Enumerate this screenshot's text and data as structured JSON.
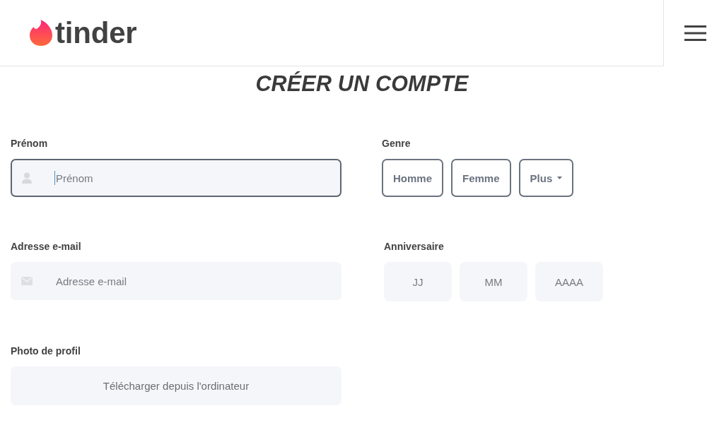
{
  "header": {
    "logo": "tinder"
  },
  "title": "CRÉER UN COMPTE",
  "form": {
    "first_name": {
      "label": "Prénom",
      "placeholder": "Prénom",
      "focused": true
    },
    "gender": {
      "label": "Genre",
      "options": [
        {
          "label": "Homme",
          "kind": "option",
          "selected": false
        },
        {
          "label": "Femme",
          "kind": "option",
          "selected": false
        },
        {
          "label": "Plus",
          "kind": "dropdown",
          "selected": false
        }
      ]
    },
    "email": {
      "label": "Adresse e-mail",
      "placeholder": "Adresse e-mail",
      "focused": false
    },
    "birthday": {
      "label": "Anniversaire",
      "fields": [
        {
          "placeholder": "JJ"
        },
        {
          "placeholder": "MM"
        },
        {
          "placeholder": "AAAA"
        }
      ]
    },
    "photo": {
      "label": "Photo de profil",
      "button": "Télécharger depuis l'ordinateur"
    }
  }
}
